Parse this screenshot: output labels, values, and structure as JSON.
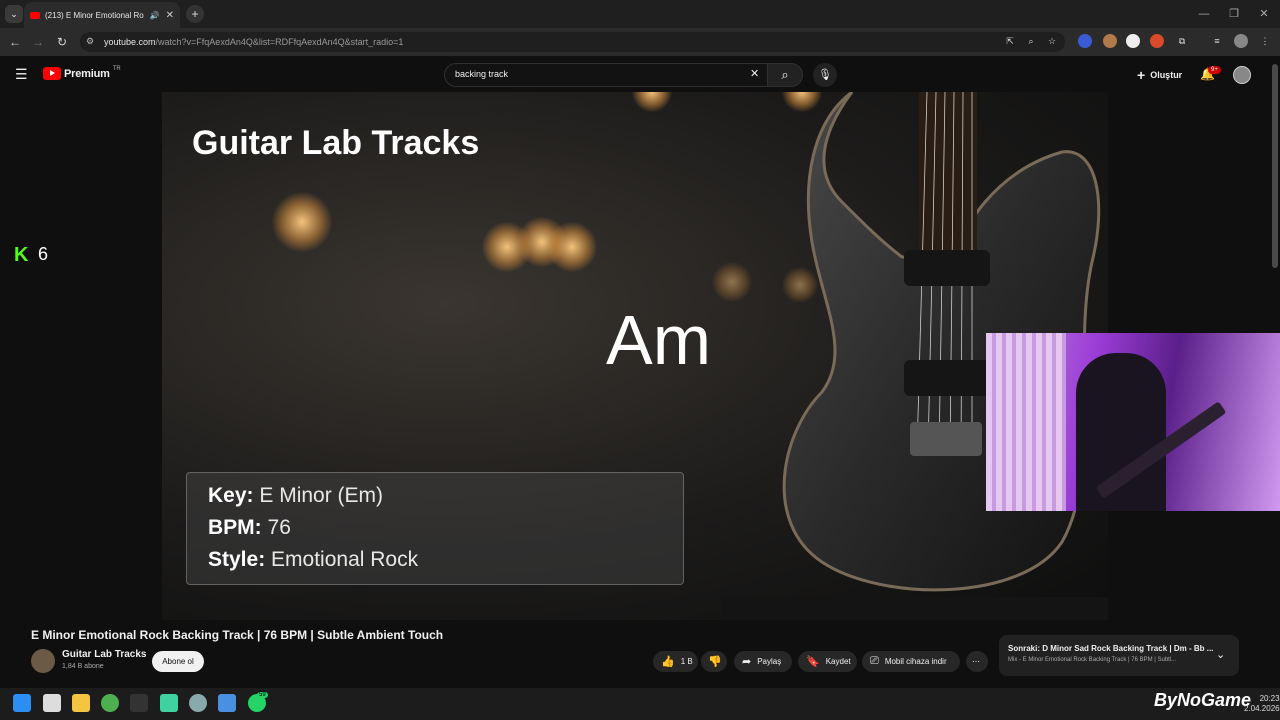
{
  "browser": {
    "tab_title": "(213) E Minor Emotional Ro",
    "url_host": "youtube.com",
    "url_path": "/watch?v=FfqAexdAn4Q&list=RDFfqAexdAn4Q&start_radio=1"
  },
  "youtube": {
    "logo_text": "Premium",
    "region": "TR",
    "search_value": "backing track",
    "create_label": "Oluştur",
    "notif_count": "9+"
  },
  "video_frame": {
    "title": "Guitar Lab Tracks",
    "chord": "Am",
    "key_label": "Key:",
    "key_value": "E Minor (Em)",
    "bpm_label": "BPM:",
    "bpm_value": "76",
    "style_label": "Style:",
    "style_value": "Emotional Rock"
  },
  "overlay": {
    "kick_letter": "K",
    "kick_count": "6"
  },
  "video_info": {
    "title": "E Minor Emotional Rock Backing Track | 76 BPM | Subtle Ambient Touch",
    "channel": "Guitar Lab Tracks",
    "subscribers": "1,84 B abone",
    "subscribe_label": "Abone ol",
    "like_count": "1 B",
    "share_label": "Paylaş",
    "save_label": "Kaydet",
    "download_label": "Mobil cihaza indir"
  },
  "up_next": {
    "label": "Sonraki: D Minor Sad Rock Backing Track | Dm - Bb ...",
    "subtitle": "Mix - E Minor Emotional Rock Backing Track | 76 BPM | Subtl..."
  },
  "taskbar": {
    "whatsapp_badge": "59",
    "time": "20:23",
    "date": "2.04.2026",
    "watermark": "ByNoGame"
  },
  "colors": {
    "yt_red": "#ff0000",
    "kick_green": "#53fc18",
    "background": "#0f0f0f"
  }
}
